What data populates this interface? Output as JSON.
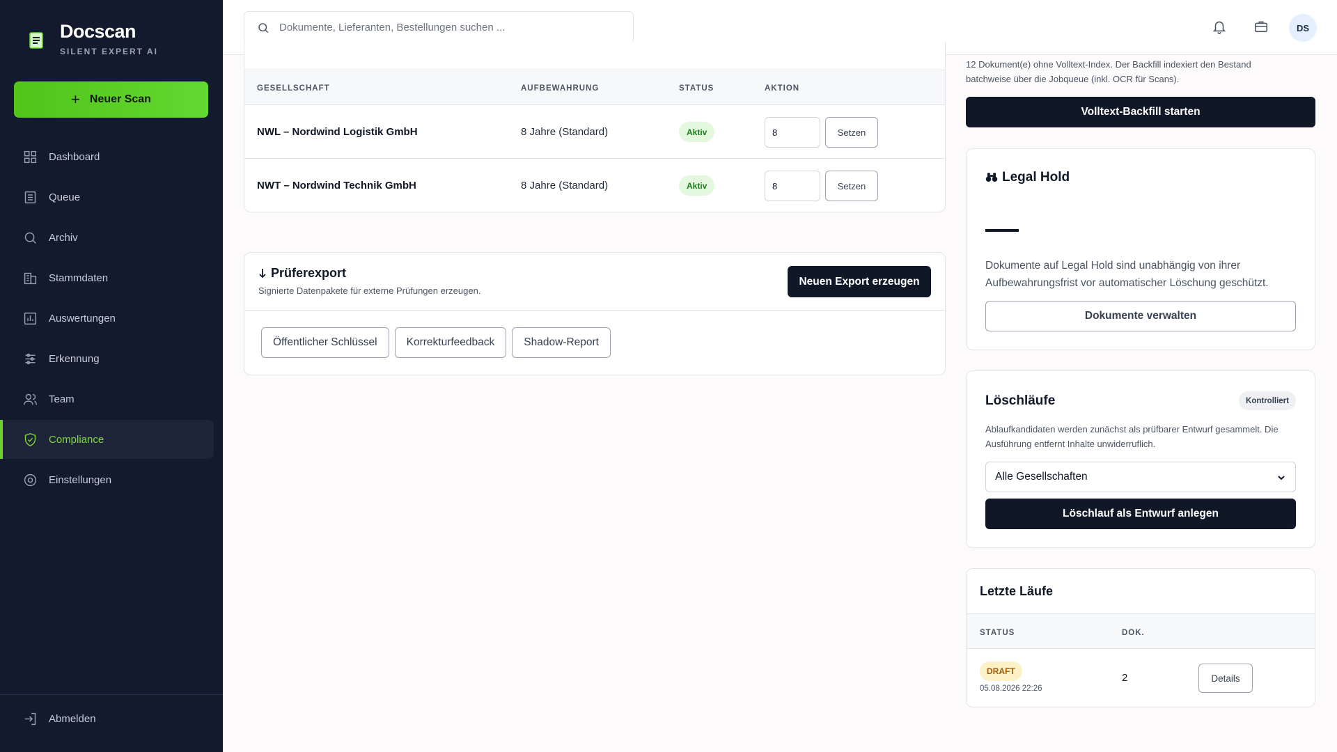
{
  "brand": {
    "name": "Docscan",
    "subtitle": "SILENT EXPERT AI"
  },
  "sidebar": {
    "new_scan_label": "Neuer Scan",
    "items": [
      {
        "label": "Dashboard",
        "icon": "grid-icon",
        "active": false
      },
      {
        "label": "Queue",
        "icon": "list-icon",
        "active": false
      },
      {
        "label": "Archiv",
        "icon": "search-icon",
        "active": false
      },
      {
        "label": "Stammdaten",
        "icon": "building-icon",
        "active": false
      },
      {
        "label": "Auswertungen",
        "icon": "chart-icon",
        "active": false
      },
      {
        "label": "Erkennung",
        "icon": "sliders-icon",
        "active": false
      },
      {
        "label": "Team",
        "icon": "users-icon",
        "active": false
      },
      {
        "label": "Compliance",
        "icon": "shield-icon",
        "active": true
      },
      {
        "label": "Einstellungen",
        "icon": "gear-icon",
        "active": false
      }
    ],
    "logout_label": "Abmelden"
  },
  "topbar": {
    "search_placeholder": "Dokumente, Lieferanten, Bestellungen suchen ...",
    "avatar_initials": "DS"
  },
  "retention_table": {
    "headers": [
      "GESELLSCHAFT",
      "AUFBEWAHRUNG",
      "STATUS",
      "AKTION"
    ],
    "rows": [
      {
        "company": "NWL – Nordwind Logistik GmbH",
        "retention": "8 Jahre (Standard)",
        "status": "Aktiv",
        "value": "8",
        "action": "Setzen"
      },
      {
        "company": "NWT – Nordwind Technik GmbH",
        "retention": "8 Jahre (Standard)",
        "status": "Aktiv",
        "value": "8",
        "action": "Setzen"
      }
    ]
  },
  "export": {
    "title": "Prüferexport",
    "subtitle": "Signierte Datenpakete für externe Prüfungen erzeugen.",
    "primary_button": "Neuen Export erzeugen",
    "buttons": [
      "Öffentlicher Schlüssel",
      "Korrekturfeedback",
      "Shadow-Report"
    ]
  },
  "backfill": {
    "text": "12 Dokument(e) ohne Volltext-Index. Der Backfill indexiert den Bestand batchweise über die Jobqueue (inkl. OCR für Scans).",
    "button": "Volltext-Backfill starten"
  },
  "legal_hold": {
    "title": "Legal Hold",
    "value": "—",
    "text": "Dokumente auf Legal Hold sind unabhängig von ihrer Aufbewahrungsfrist vor automatischer Löschung geschützt.",
    "button": "Dokumente verwalten"
  },
  "deletion": {
    "title": "Löschläufe",
    "badge": "Kontrolliert",
    "text": "Ablaufkandidaten werden zunächst als prüfbarer Entwurf gesammelt. Die Ausführung entfernt Inhalte unwiderruflich.",
    "select_value": "Alle Gesellschaften",
    "button": "Löschlauf als Entwurf anlegen"
  },
  "recent_runs": {
    "title": "Letzte Läufe",
    "headers": [
      "STATUS",
      "DOK."
    ],
    "rows": [
      {
        "status": "DRAFT",
        "date": "05.08.2026 22:26",
        "count": "2",
        "action": "Details"
      }
    ]
  },
  "colors": {
    "sidebar_bg": "#141a2e",
    "accent": "#62d832",
    "dark_button": "#101828"
  }
}
